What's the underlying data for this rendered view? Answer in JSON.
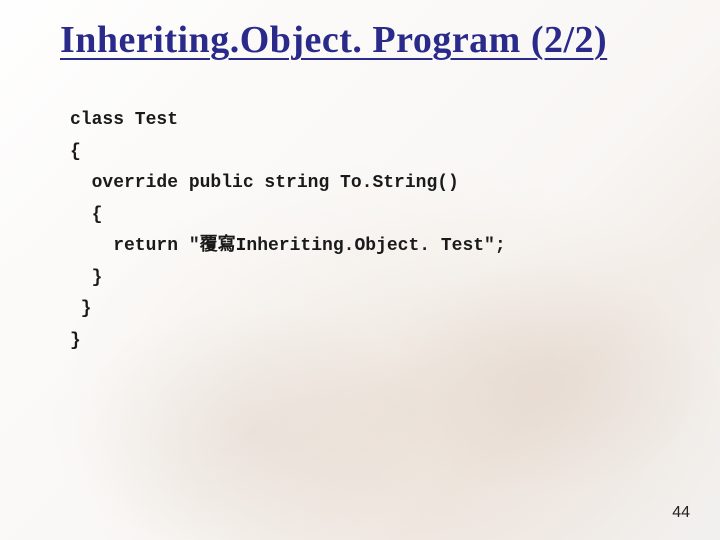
{
  "slide": {
    "title": "Inheriting.Object. Program (2/2)",
    "page_number": "44"
  },
  "code": {
    "line1": "class Test",
    "line2": "{",
    "line3": "  override public string To.String()",
    "line4": "  {",
    "line5": "    return \"覆寫Inheriting.Object. Test\";",
    "line6": "  }",
    "line7": " }",
    "line8": "}"
  }
}
